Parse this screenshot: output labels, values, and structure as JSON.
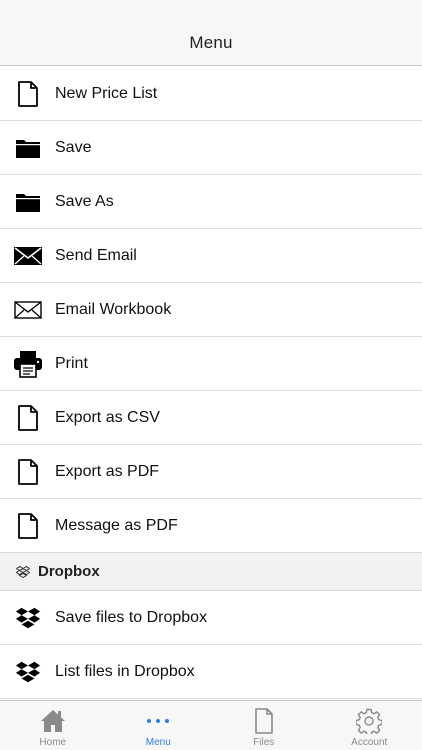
{
  "navbar": {
    "title": "Menu"
  },
  "menu": {
    "items": [
      {
        "label": "New Price List",
        "icon": "document-icon"
      },
      {
        "label": "Save",
        "icon": "folder-icon"
      },
      {
        "label": "Save As",
        "icon": "folder-icon"
      },
      {
        "label": "Send Email",
        "icon": "envelope-filled-icon"
      },
      {
        "label": "Email Workbook",
        "icon": "envelope-outline-icon"
      },
      {
        "label": "Print",
        "icon": "printer-icon"
      },
      {
        "label": "Export as CSV",
        "icon": "document-icon"
      },
      {
        "label": "Export as PDF",
        "icon": "document-icon"
      },
      {
        "label": "Message as PDF",
        "icon": "document-icon"
      }
    ],
    "dropbox_section": {
      "title": "Dropbox",
      "icon": "dropbox-icon"
    },
    "dropbox_items": [
      {
        "label": "Save files to Dropbox",
        "icon": "dropbox-icon"
      },
      {
        "label": "List files in Dropbox",
        "icon": "dropbox-icon"
      }
    ]
  },
  "tabbar": {
    "active": "Menu",
    "active_color": "#2f7de1",
    "tabs": [
      {
        "label": "Home",
        "icon": "house-icon"
      },
      {
        "label": "Menu",
        "icon": "ellipsis-icon"
      },
      {
        "label": "Files",
        "icon": "document-icon"
      },
      {
        "label": "Account",
        "icon": "gear-icon"
      }
    ]
  }
}
